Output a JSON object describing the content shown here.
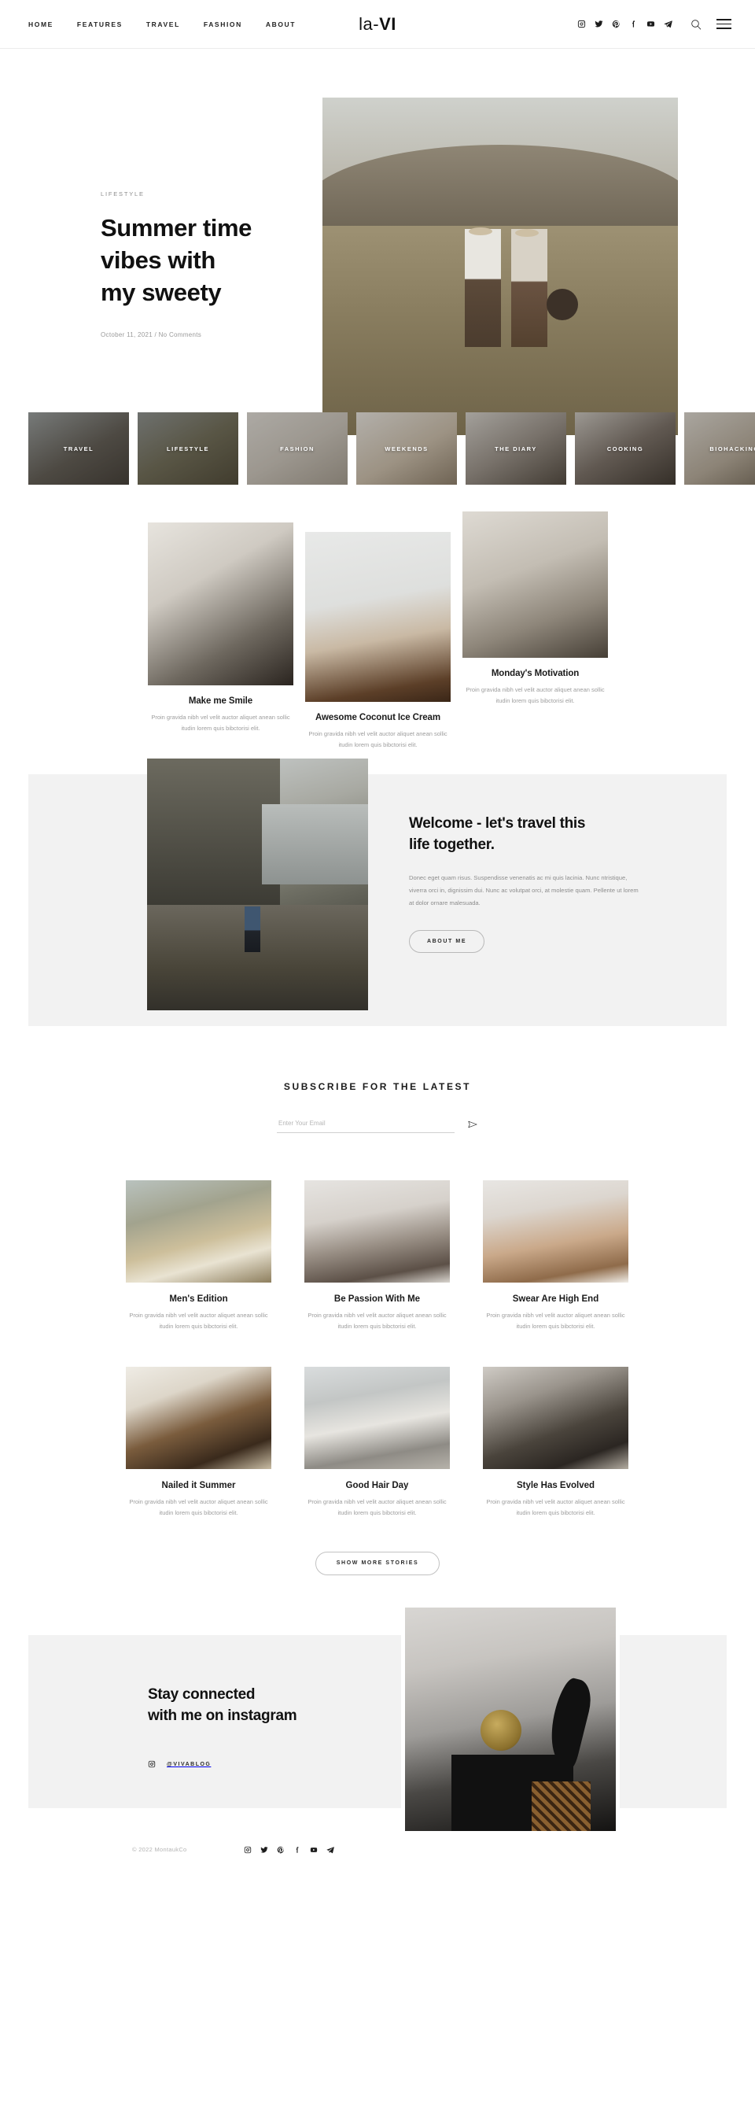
{
  "header": {
    "nav": [
      {
        "label": "HOME"
      },
      {
        "label": "FEATURES"
      },
      {
        "label": "TRAVEL"
      },
      {
        "label": "FASHION"
      },
      {
        "label": "ABOUT"
      }
    ],
    "brand_prefix": "la-",
    "brand_suffix": "VI",
    "social": [
      {
        "name": "instagram-icon"
      },
      {
        "name": "twitter-icon"
      },
      {
        "name": "pinterest-icon"
      },
      {
        "name": "facebook-icon"
      },
      {
        "name": "youtube-icon"
      },
      {
        "name": "telegram-icon"
      }
    ],
    "search_icon": "search-icon",
    "menu_icon": "hamburger-menu-icon"
  },
  "hero": {
    "category": "LIFESTYLE",
    "title_line1": "Summer time",
    "title_line2": "vibes with",
    "title_line3": "my sweety",
    "meta": "October 11, 2021 / No Comments"
  },
  "categories": [
    {
      "label": "TRAVEL"
    },
    {
      "label": "LIFESTYLE"
    },
    {
      "label": "FASHION"
    },
    {
      "label": "WEEKENDS"
    },
    {
      "label": "THE DIARY"
    },
    {
      "label": "COOKING"
    },
    {
      "label": "BIOHACKING"
    }
  ],
  "featured": [
    {
      "title": "Make me Smile",
      "excerpt": "Proin gravida nibh vel velit auctor aliquet anean sollic itudin lorem quis bibctorisi elit."
    },
    {
      "title": "Awesome Coconut Ice Cream",
      "excerpt": "Proin gravida nibh vel velit auctor aliquet anean sollic itudin lorem quis bibctorisi elit."
    },
    {
      "title": "Monday's Motivation",
      "excerpt": "Proin gravida nibh vel velit auctor aliquet anean sollic itudin lorem quis bibctorisi elit."
    }
  ],
  "welcome": {
    "title_line1": "Welcome - let's travel this",
    "title_line2": "life together.",
    "body": "Donec eget quam risus. Suspendisse venenatis ac mi quis lacinia. Nunc ntristique, viverra orci in, dignissim dui. Nunc ac volutpat orci, at molestie quam. Pellente ut lorem at dolor ornare malesuada.",
    "button_label": "ABOUT ME"
  },
  "subscribe": {
    "heading": "SUBSCRIBE FOR THE LATEST",
    "placeholder": "Enter Your Email",
    "value": "",
    "submit_icon": "send-icon"
  },
  "posts": [
    {
      "title": "Men's Edition",
      "excerpt": "Proin gravida nibh vel velit auctor aliquet anean sollic itudin lorem quis bibctorisi elit."
    },
    {
      "title": "Be Passion With Me",
      "excerpt": "Proin gravida nibh vel velit auctor aliquet anean sollic itudin lorem quis bibctorisi elit."
    },
    {
      "title": "Swear Are High End",
      "excerpt": "Proin gravida nibh vel velit auctor aliquet anean sollic itudin lorem quis bibctorisi elit."
    },
    {
      "title": "Nailed it Summer",
      "excerpt": "Proin gravida nibh vel velit auctor aliquet anean sollic itudin lorem quis bibctorisi elit."
    },
    {
      "title": "Good Hair Day",
      "excerpt": "Proin gravida nibh vel velit auctor aliquet anean sollic itudin lorem quis bibctorisi elit."
    },
    {
      "title": "Style Has Evolved",
      "excerpt": "Proin gravida nibh vel velit auctor aliquet anean sollic itudin lorem quis bibctorisi elit."
    }
  ],
  "show_more_label": "SHOW MORE STORIES",
  "instagram": {
    "title_line1": "Stay connected",
    "title_line2": "with me on instagram",
    "handle": "@VIVABLOG",
    "handle_icon": "instagram-icon"
  },
  "footer": {
    "copyright": "© 2022 MontaukCo",
    "social": [
      {
        "name": "instagram-icon"
      },
      {
        "name": "twitter-icon"
      },
      {
        "name": "pinterest-icon"
      },
      {
        "name": "facebook-icon"
      },
      {
        "name": "youtube-icon"
      },
      {
        "name": "telegram-icon"
      }
    ]
  },
  "colors": {
    "background": "#ffffff",
    "band": "#f2f2f2",
    "text": "#1a1a1a",
    "muted": "#9d9d9d",
    "rule": "#cfcfcf"
  }
}
